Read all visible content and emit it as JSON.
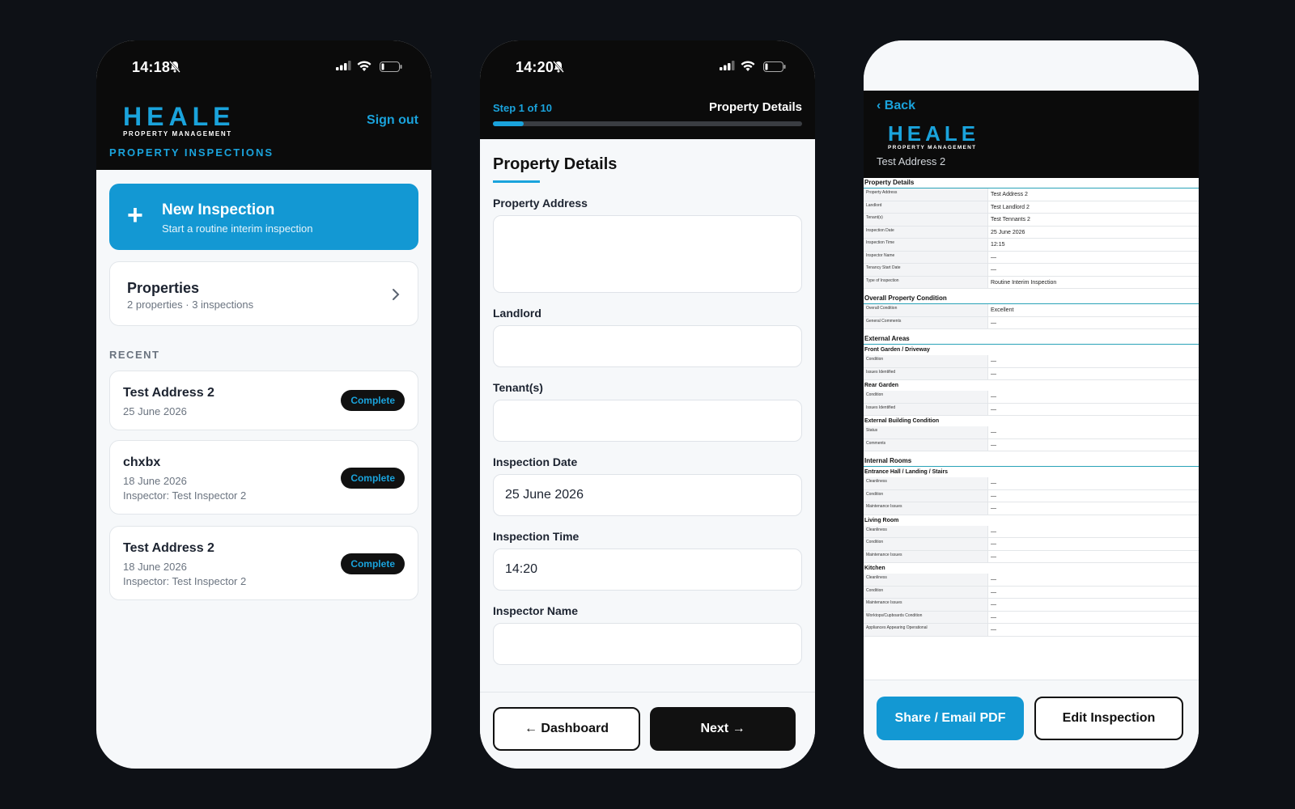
{
  "colors": {
    "accent": "#1aa3dc",
    "primary_button": "#1398d3",
    "dark": "#0b0b0b",
    "background": "#0e1116"
  },
  "screen1": {
    "status": {
      "time": "14:18"
    },
    "brand": {
      "name": "HEALE",
      "tagline": "PROPERTY MANAGEMENT"
    },
    "sign_out": "Sign out",
    "subtitle": "PROPERTY INSPECTIONS",
    "new_inspection": {
      "icon": "plus-icon",
      "title": "New Inspection",
      "subtitle": "Start a routine interim inspection"
    },
    "properties": {
      "title": "Properties",
      "subtitle": "2 properties · 3 inspections",
      "icon": "chevron-right-icon"
    },
    "recent_label": "RECENT",
    "recent": [
      {
        "title": "Test Address 2",
        "date": "25 June 2026",
        "inspector": "",
        "status": "Complete"
      },
      {
        "title": "chxbx",
        "date": "18 June 2026",
        "inspector": "Inspector: Test Inspector 2",
        "status": "Complete"
      },
      {
        "title": "Test Address 2",
        "date": "18 June 2026",
        "inspector": "Inspector: Test Inspector 2",
        "status": "Complete"
      }
    ]
  },
  "screen2": {
    "status": {
      "time": "14:20"
    },
    "step": "Step 1 of 10",
    "step_title": "Property Details",
    "progress": 0.1,
    "form_title": "Property Details",
    "fields": [
      {
        "label": "Property Address",
        "value": ""
      },
      {
        "label": "Landlord",
        "value": ""
      },
      {
        "label": "Tenant(s)",
        "value": ""
      },
      {
        "label": "Inspection Date",
        "value": "25 June 2026"
      },
      {
        "label": "Inspection Time",
        "value": "14:20"
      },
      {
        "label": "Inspector Name",
        "value": ""
      }
    ],
    "dashboard_button": "← Dashboard",
    "next_button": "Next →"
  },
  "screen3": {
    "back": "‹ Back",
    "brand": {
      "name": "HEALE",
      "tagline": "PROPERTY MANAGEMENT"
    },
    "address": "Test Address 2",
    "report": {
      "property_details": {
        "title": "Property Details",
        "rows": [
          [
            "Property Address",
            "Test Address 2"
          ],
          [
            "Landlord",
            "Test Landlord 2"
          ],
          [
            "Tenant(s)",
            "Test Tennants 2"
          ],
          [
            "Inspection Date",
            "25 June 2026"
          ],
          [
            "Inspection Time",
            "12:15"
          ],
          [
            "Inspector Name",
            "—"
          ],
          [
            "Tenancy Start Date",
            "—"
          ],
          [
            "Type of Inspection",
            "Routine Interim Inspection"
          ]
        ]
      },
      "overall": {
        "title": "Overall Property Condition",
        "rows": [
          [
            "Overall Condition",
            "Excellent"
          ],
          [
            "General Comments",
            "—"
          ]
        ]
      },
      "external": {
        "title": "External Areas",
        "groups": [
          {
            "name": "Front Garden / Driveway",
            "rows": [
              [
                "Condition",
                "—"
              ],
              [
                "Issues Identified",
                "—"
              ]
            ]
          },
          {
            "name": "Rear Garden",
            "rows": [
              [
                "Condition",
                "—"
              ],
              [
                "Issues Identified",
                "—"
              ]
            ]
          },
          {
            "name": "External Building Condition",
            "rows": [
              [
                "Status",
                "—"
              ],
              [
                "Comments",
                "—"
              ]
            ]
          }
        ]
      },
      "internal": {
        "title": "Internal Rooms",
        "groups": [
          {
            "name": "Entrance Hall / Landing / Stairs",
            "rows": [
              [
                "Cleanliness",
                "—"
              ],
              [
                "Condition",
                "—"
              ],
              [
                "Maintenance Issues",
                "—"
              ]
            ]
          },
          {
            "name": "Living Room",
            "rows": [
              [
                "Cleanliness",
                "—"
              ],
              [
                "Condition",
                "—"
              ],
              [
                "Maintenance Issues",
                "—"
              ]
            ]
          },
          {
            "name": "Kitchen",
            "rows": [
              [
                "Cleanliness",
                "—"
              ],
              [
                "Condition",
                "—"
              ],
              [
                "Maintenance Issues",
                "—"
              ],
              [
                "Worktops/Cupboards Condition",
                "—"
              ],
              [
                "Appliances Appearing Operational",
                "—"
              ]
            ]
          }
        ]
      }
    },
    "share_button": "Share / Email PDF",
    "edit_button": "Edit Inspection"
  }
}
